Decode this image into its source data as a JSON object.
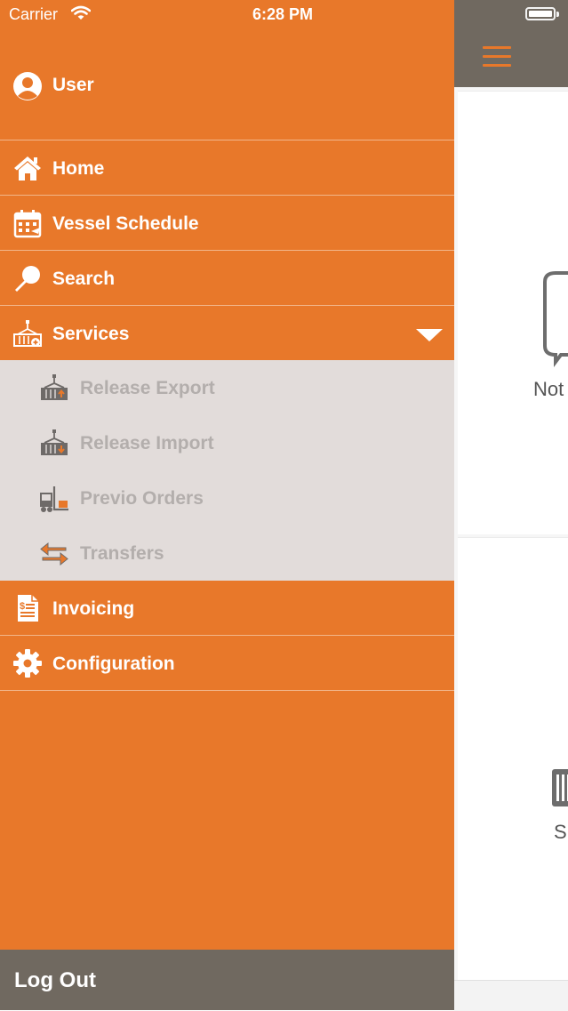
{
  "status_bar": {
    "carrier": "Carrier",
    "time": "6:28 PM"
  },
  "user": {
    "label": "User",
    "icon": "user-circle-icon"
  },
  "menu": {
    "home": {
      "label": "Home",
      "icon": "home-icon"
    },
    "vessel_schedule": {
      "label": "Vessel Schedule",
      "icon": "calendar-icon"
    },
    "search": {
      "label": "Search",
      "icon": "search-icon"
    },
    "services": {
      "label": "Services",
      "icon": "crane-container-icon",
      "expanded": true
    },
    "invoicing": {
      "label": "Invoicing",
      "icon": "invoice-icon"
    },
    "configuration": {
      "label": "Configuration",
      "icon": "gear-icon"
    }
  },
  "services_submenu": [
    {
      "label": "Release Export",
      "icon": "crane-export-icon"
    },
    {
      "label": "Release Import",
      "icon": "crane-import-icon"
    },
    {
      "label": "Previo Orders",
      "icon": "forklift-icon"
    },
    {
      "label": "Transfers",
      "icon": "transfer-arrows-icon"
    }
  ],
  "logout": {
    "label": "Log Out"
  },
  "background_app": {
    "card_1_label": "Not",
    "card_2_label": "S"
  },
  "colors": {
    "drawer_orange": "#e8782a",
    "submenu_gray": "#e2dcda",
    "submenu_text": "#b3aeac",
    "header_brown": "#706960"
  }
}
